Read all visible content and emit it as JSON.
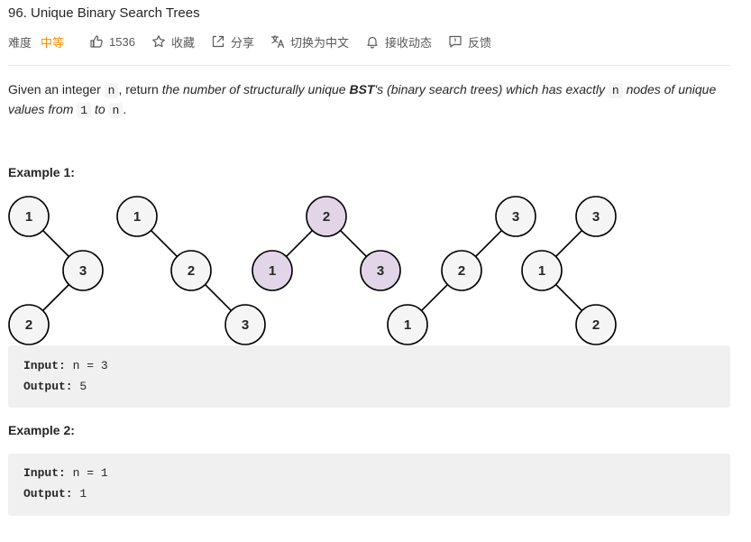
{
  "problem": {
    "title": "96. Unique Binary Search Trees"
  },
  "meta": {
    "difficulty_label": "难度",
    "difficulty": "中等",
    "likes": "1536",
    "favorite": "收藏",
    "share": "分享",
    "switch_lang": "切换为中文",
    "notify": "接收动态",
    "feedback": "反馈"
  },
  "description": {
    "p1": "Given an integer ",
    "code_n": "n",
    "p2": ", return ",
    "p3": "the number of structurally unique ",
    "bst": "BST",
    "p4": "'s (binary search trees) which has exactly ",
    "p5": " nodes of unique values from ",
    "code_1": "1",
    "p6": " to ",
    "p7": "."
  },
  "example1": {
    "title": "Example 1:",
    "input_label": "Input:",
    "input_value": " n = 3",
    "output_label": "Output:",
    "output_value": " 5"
  },
  "example2": {
    "title": "Example 2:",
    "input_label": "Input:",
    "input_value": " n = 1",
    "output_label": "Output:",
    "output_value": " 1"
  },
  "diagram": {
    "node_fill_default": "#f5f5f5",
    "node_fill_highlight": "#e1d5e7",
    "trees": [
      {
        "nodes": [
          "1",
          "3",
          "2"
        ]
      },
      {
        "nodes": [
          "1",
          "2",
          "3"
        ]
      },
      {
        "nodes": [
          "2",
          "1",
          "3"
        ],
        "highlight": true
      },
      {
        "nodes": [
          "3",
          "2",
          "1"
        ]
      },
      {
        "nodes": [
          "3",
          "1",
          "2"
        ]
      }
    ]
  },
  "icons": {
    "like": "thumbs-up-icon",
    "favorite": "star-icon",
    "share": "share-icon",
    "translate": "translate-icon",
    "notify": "bell-icon",
    "feedback": "feedback-icon"
  }
}
